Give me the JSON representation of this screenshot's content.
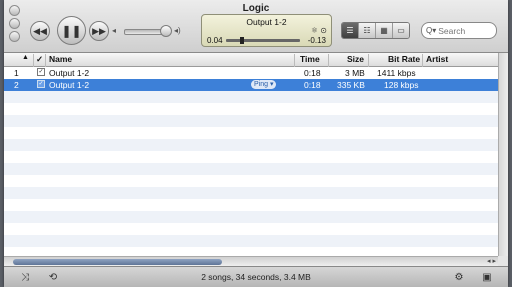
{
  "window": {
    "title": "Logic"
  },
  "player": {
    "song": "Output 1-2",
    "elapsed": "0.04",
    "remaining": "-0.13",
    "progress": 0.23,
    "volume": 0.8
  },
  "search": {
    "placeholder": "Search"
  },
  "columns": [
    "Name",
    "Time",
    "Size",
    "Bit Rate",
    "Artist"
  ],
  "rows": [
    {
      "num": "1",
      "name": "Output 1-2",
      "time": "0:18",
      "size": "3 MB",
      "bitrate": "1411 kbps",
      "artist": "",
      "selected": false
    },
    {
      "num": "2",
      "name": "Output 1-2",
      "time": "0:18",
      "size": "335 KB",
      "bitrate": "128 kbps",
      "artist": "",
      "selected": true,
      "badge": "Ping"
    }
  ],
  "status": {
    "text": "2 songs, 34 seconds, 3.4 MB"
  },
  "icons": [
    "rewind-icon",
    "pause-icon",
    "fast-forward-icon",
    "speaker-icon",
    "genius-icon",
    "search-icon",
    "shuffle-icon",
    "repeat-icon",
    "gear-icon",
    "display-icon"
  ]
}
